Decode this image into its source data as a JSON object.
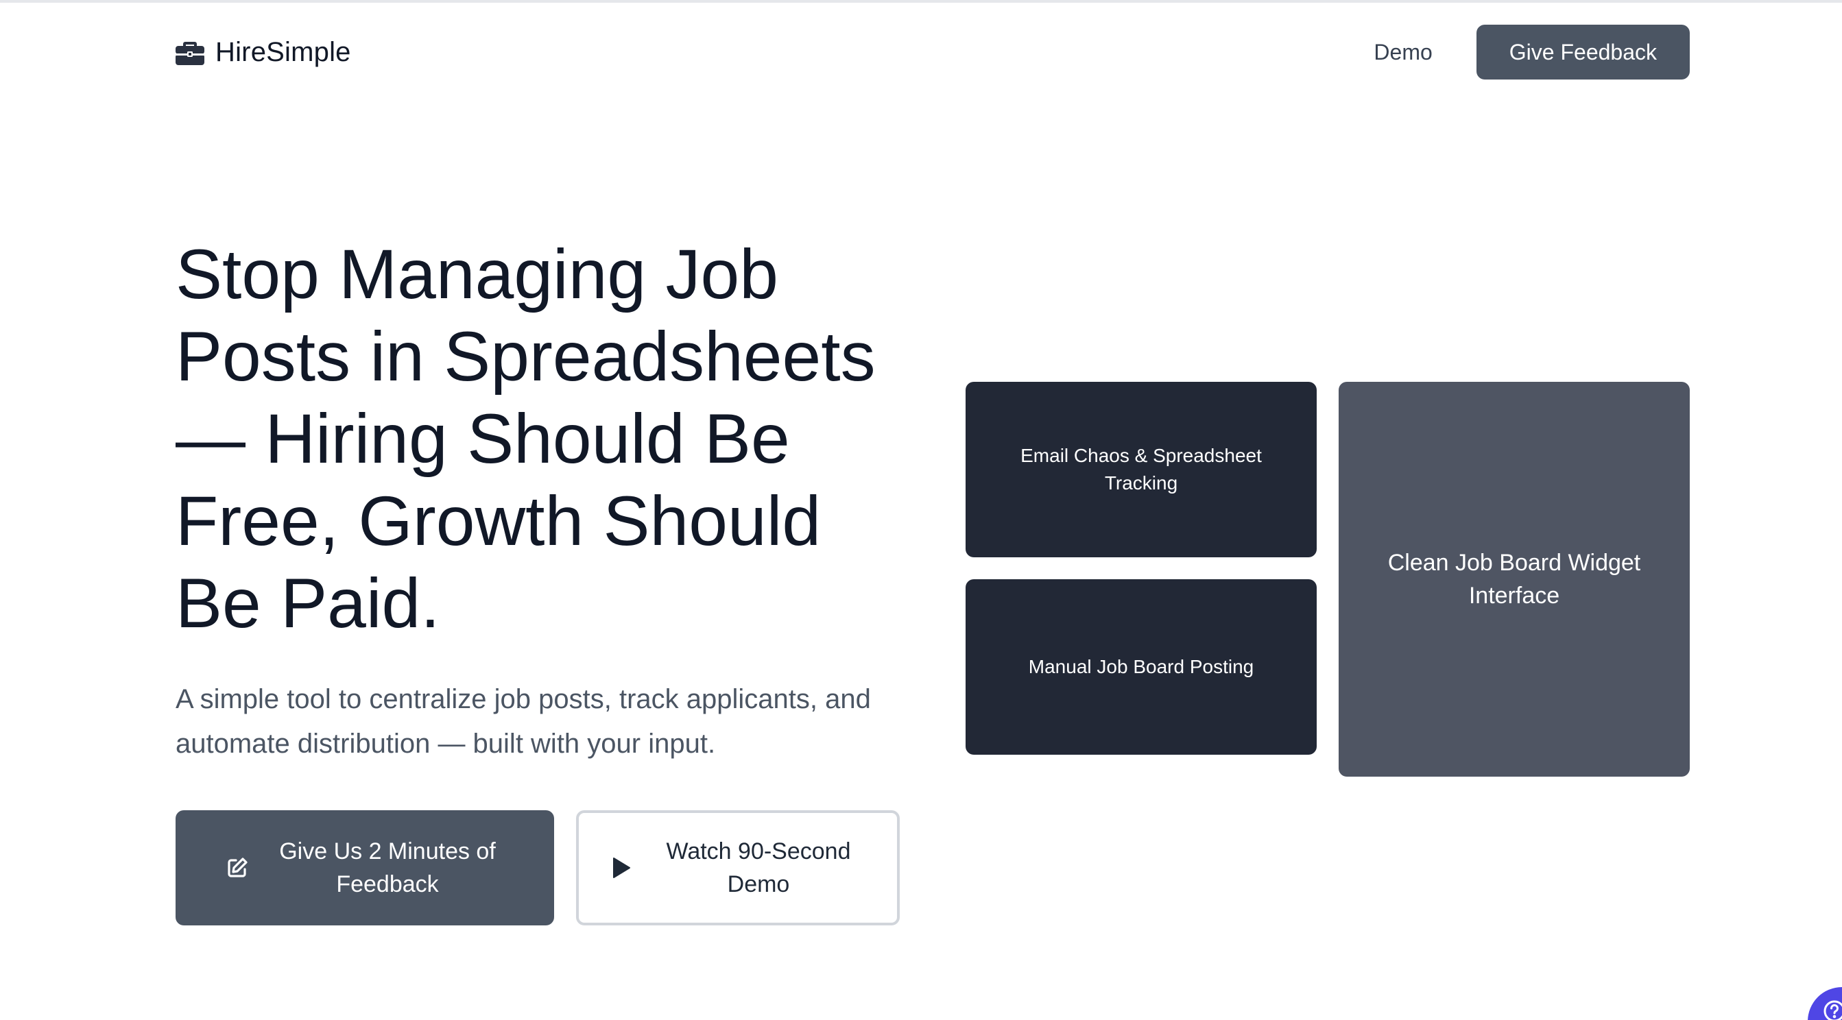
{
  "header": {
    "brand_name": "HireSimple",
    "brand_icon": "briefcase-icon",
    "nav_demo": "Demo",
    "feedback_button": "Give Feedback"
  },
  "hero": {
    "title": "Stop Managing Job Posts in Spreadsheets — Hiring Should Be Free, Growth Should Be Paid.",
    "subtitle": "A simple tool to centralize job posts, track applicants, and automate distribution — built with your input.",
    "cta_primary": {
      "label": "Give Us 2 Minutes of Feedback",
      "icon": "edit-icon"
    },
    "cta_secondary": {
      "label": "Watch 90-Second Demo",
      "icon": "play-icon"
    }
  },
  "cards": {
    "card1": "Email Chaos & Spreadsheet Tracking",
    "card2": "Manual Job Board Posting",
    "card3": "Clean Job Board Widget Interface"
  },
  "help_widget": {
    "icon": "help-icon"
  },
  "colors": {
    "primary_button": "#4b5563",
    "card_dark": "#222836",
    "card_gray": "#4f5563",
    "help_bubble": "#4f46e5"
  }
}
